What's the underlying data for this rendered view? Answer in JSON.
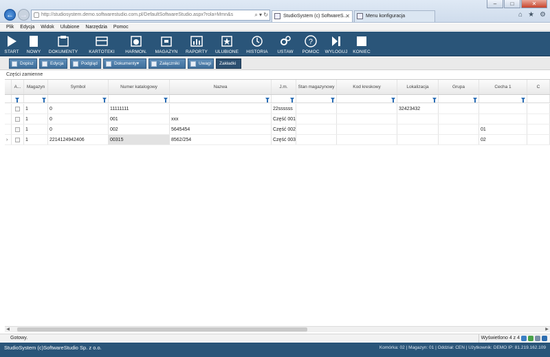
{
  "browser": {
    "address": "http://studiosystem.demo.softwarestudio.com.pl/DefaultSoftwareStudio.aspx?rola=Mmn&s",
    "address_host": "softwarestudio.com.pl",
    "tabs": [
      {
        "label": "StudioSystem (c) SoftwareS..."
      },
      {
        "label": "Menu konfiguracja"
      }
    ]
  },
  "menubar": [
    "Plik",
    "Edycja",
    "Widok",
    "Ulubione",
    "Narzędzia",
    "Pomoc"
  ],
  "toolbar": [
    {
      "label": "START",
      "icon": "play-icon"
    },
    {
      "label": "NOWY",
      "icon": "new-document-icon"
    },
    {
      "label": "DOKUMENTY",
      "icon": "documents-icon"
    },
    {
      "label": "KARTOTEKI",
      "icon": "card-index-icon"
    },
    {
      "label": "HARMON.",
      "icon": "schedule-icon"
    },
    {
      "label": "MAGAZYN",
      "icon": "warehouse-icon"
    },
    {
      "label": "RAPORTY",
      "icon": "reports-icon"
    },
    {
      "label": "ULUBIONE",
      "icon": "favorites-icon"
    },
    {
      "label": "HISTORIA",
      "icon": "history-icon"
    },
    {
      "label": "USTAW",
      "icon": "settings-icon"
    },
    {
      "label": "POMOC",
      "icon": "help-icon"
    },
    {
      "label": "WYLOGUJ",
      "icon": "logout-icon"
    },
    {
      "label": "KONIEC",
      "icon": "stop-icon"
    }
  ],
  "subtoolbar": [
    {
      "label": "Dopisz"
    },
    {
      "label": "Edycja"
    },
    {
      "label": "Podgląd"
    },
    {
      "label": "Dokumenty"
    },
    {
      "label": "Załączniki"
    },
    {
      "label": "Uwagi"
    },
    {
      "label": "Zakładki"
    }
  ],
  "section_title": "Części zamienne",
  "grid": {
    "headers": [
      "A...",
      "Magazyn",
      "Symbol",
      "Numer katalogowy",
      "Nazwa",
      "J.m.",
      "Stan magazynowy",
      "Kod kreskowy",
      "Lokalizacja",
      "Grupa",
      "Cecha 1",
      "C"
    ],
    "rows": [
      [
        "",
        "1",
        "0",
        "11111111",
        "",
        "22ssssss",
        "",
        "",
        "32423432",
        "",
        "",
        ""
      ],
      [
        "",
        "1",
        "0",
        "001",
        "xxx",
        "Część 001",
        "",
        "",
        "",
        "",
        "",
        ""
      ],
      [
        "",
        "1",
        "0",
        "002",
        "5645454",
        "Część 002",
        "",
        "",
        "",
        "",
        "01",
        ""
      ],
      [
        "",
        "1",
        "2214124942406",
        "00315",
        "8562/254",
        "Część 003",
        "",
        "",
        "",
        "",
        "02",
        ""
      ]
    ]
  },
  "status": {
    "left": "Gotowy.",
    "right": "Wyświetlono 4 z 4"
  },
  "footer": {
    "brand": "StudioSystem (c)SoftwareStudio Sp. z o.o.",
    "info": "Komórka: 02 | Magazyn: 01 | Oddział: CEN | Użytkownik: DEMO IP: 81.219.162.109"
  },
  "colors": {
    "toolbar_bg": "#2a5579",
    "button_bg": "#4f7fab",
    "filter_icon": "#2a6db5"
  }
}
